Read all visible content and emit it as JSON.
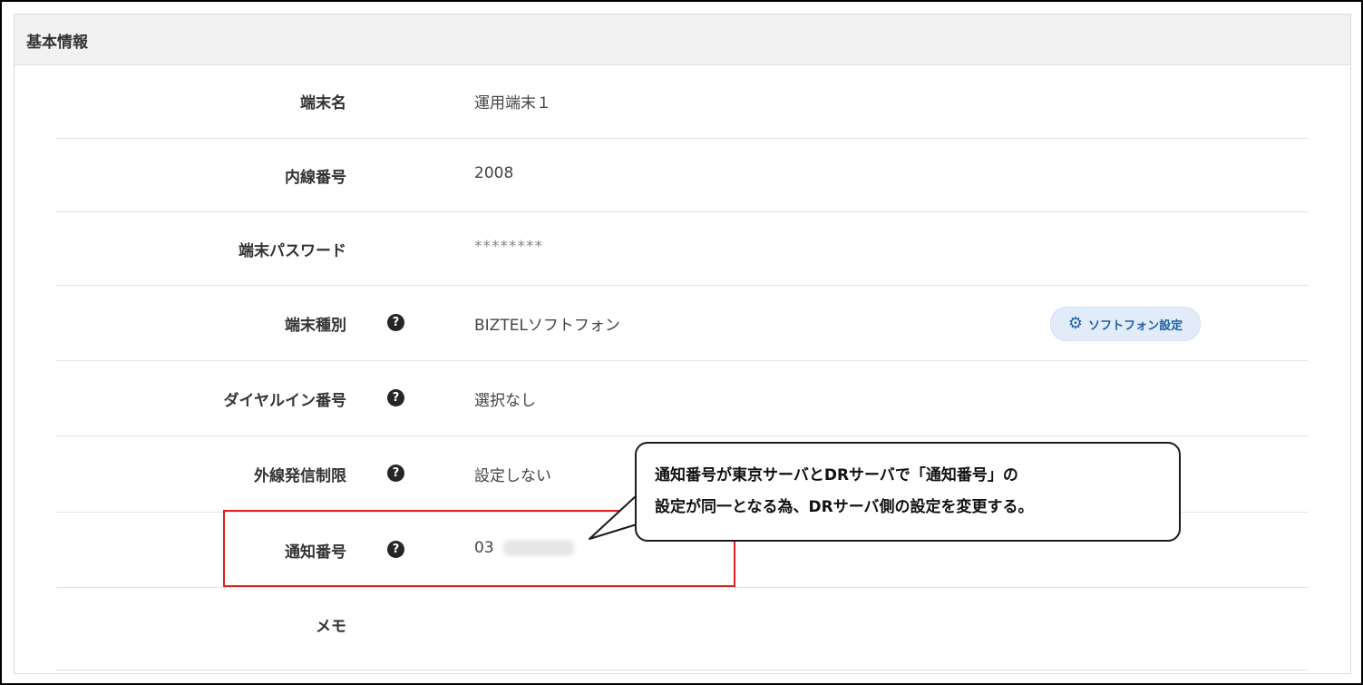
{
  "panel": {
    "title": "基本情報"
  },
  "rows": [
    {
      "label": "端末名",
      "value": "運用端末１",
      "help": false
    },
    {
      "label": "内線番号",
      "value": "2008",
      "help": false
    },
    {
      "label": "端末パスワード",
      "value": "********",
      "help": false
    },
    {
      "label": "端末種別",
      "value": "BIZTELソフトフォン",
      "help": true
    },
    {
      "label": "ダイヤルイン番号",
      "value": "選択なし",
      "help": true
    },
    {
      "label": "外線発信制限",
      "value": "設定しない",
      "help": true
    },
    {
      "label": "通知番号",
      "value": "03",
      "help": true
    },
    {
      "label": "メモ",
      "value": "",
      "help": false
    }
  ],
  "help_icon_glyph": "?",
  "softphone_button": {
    "label": "ソフトフォン設定",
    "icon": "gear-icon",
    "gear_glyph": "⚙"
  },
  "callout": {
    "line1": "通知番号が東京サーバとDRサーバで「通知番号」の",
    "line2": "設定が同一となる為、DRサーバ側の設定を変更する。"
  },
  "colors": {
    "highlight_border": "#e02020",
    "button_bg": "#e2ecf9",
    "button_text": "#1f5fa8",
    "header_bg": "#f2f2f2"
  }
}
